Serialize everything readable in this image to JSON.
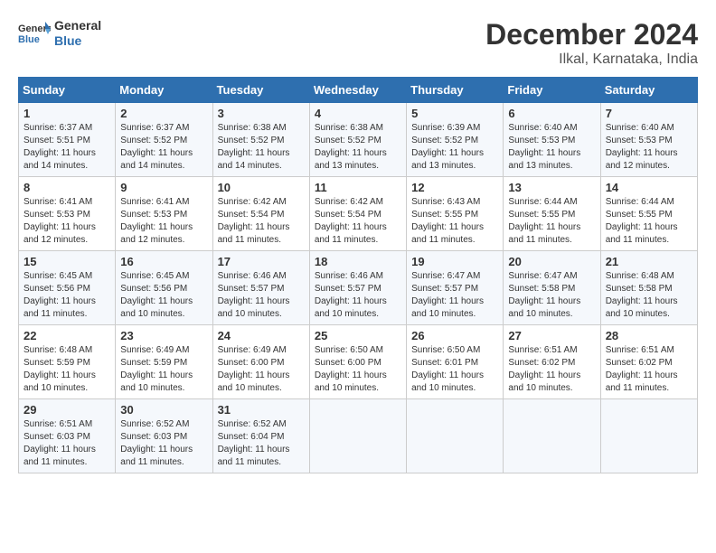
{
  "header": {
    "logo_line1": "General",
    "logo_line2": "Blue",
    "month": "December 2024",
    "location": "Ilkal, Karnataka, India"
  },
  "weekdays": [
    "Sunday",
    "Monday",
    "Tuesday",
    "Wednesday",
    "Thursday",
    "Friday",
    "Saturday"
  ],
  "weeks": [
    [
      {
        "day": "1",
        "sunrise": "6:37 AM",
        "sunset": "5:51 PM",
        "daylight": "Daylight: 11 hours and 14 minutes."
      },
      {
        "day": "2",
        "sunrise": "6:37 AM",
        "sunset": "5:52 PM",
        "daylight": "Daylight: 11 hours and 14 minutes."
      },
      {
        "day": "3",
        "sunrise": "6:38 AM",
        "sunset": "5:52 PM",
        "daylight": "Daylight: 11 hours and 14 minutes."
      },
      {
        "day": "4",
        "sunrise": "6:38 AM",
        "sunset": "5:52 PM",
        "daylight": "Daylight: 11 hours and 13 minutes."
      },
      {
        "day": "5",
        "sunrise": "6:39 AM",
        "sunset": "5:52 PM",
        "daylight": "Daylight: 11 hours and 13 minutes."
      },
      {
        "day": "6",
        "sunrise": "6:40 AM",
        "sunset": "5:53 PM",
        "daylight": "Daylight: 11 hours and 13 minutes."
      },
      {
        "day": "7",
        "sunrise": "6:40 AM",
        "sunset": "5:53 PM",
        "daylight": "Daylight: 11 hours and 12 minutes."
      }
    ],
    [
      {
        "day": "8",
        "sunrise": "6:41 AM",
        "sunset": "5:53 PM",
        "daylight": "Daylight: 11 hours and 12 minutes."
      },
      {
        "day": "9",
        "sunrise": "6:41 AM",
        "sunset": "5:53 PM",
        "daylight": "Daylight: 11 hours and 12 minutes."
      },
      {
        "day": "10",
        "sunrise": "6:42 AM",
        "sunset": "5:54 PM",
        "daylight": "Daylight: 11 hours and 11 minutes."
      },
      {
        "day": "11",
        "sunrise": "6:42 AM",
        "sunset": "5:54 PM",
        "daylight": "Daylight: 11 hours and 11 minutes."
      },
      {
        "day": "12",
        "sunrise": "6:43 AM",
        "sunset": "5:55 PM",
        "daylight": "Daylight: 11 hours and 11 minutes."
      },
      {
        "day": "13",
        "sunrise": "6:44 AM",
        "sunset": "5:55 PM",
        "daylight": "Daylight: 11 hours and 11 minutes."
      },
      {
        "day": "14",
        "sunrise": "6:44 AM",
        "sunset": "5:55 PM",
        "daylight": "Daylight: 11 hours and 11 minutes."
      }
    ],
    [
      {
        "day": "15",
        "sunrise": "6:45 AM",
        "sunset": "5:56 PM",
        "daylight": "Daylight: 11 hours and 11 minutes."
      },
      {
        "day": "16",
        "sunrise": "6:45 AM",
        "sunset": "5:56 PM",
        "daylight": "Daylight: 11 hours and 10 minutes."
      },
      {
        "day": "17",
        "sunrise": "6:46 AM",
        "sunset": "5:57 PM",
        "daylight": "Daylight: 11 hours and 10 minutes."
      },
      {
        "day": "18",
        "sunrise": "6:46 AM",
        "sunset": "5:57 PM",
        "daylight": "Daylight: 11 hours and 10 minutes."
      },
      {
        "day": "19",
        "sunrise": "6:47 AM",
        "sunset": "5:57 PM",
        "daylight": "Daylight: 11 hours and 10 minutes."
      },
      {
        "day": "20",
        "sunrise": "6:47 AM",
        "sunset": "5:58 PM",
        "daylight": "Daylight: 11 hours and 10 minutes."
      },
      {
        "day": "21",
        "sunrise": "6:48 AM",
        "sunset": "5:58 PM",
        "daylight": "Daylight: 11 hours and 10 minutes."
      }
    ],
    [
      {
        "day": "22",
        "sunrise": "6:48 AM",
        "sunset": "5:59 PM",
        "daylight": "Daylight: 11 hours and 10 minutes."
      },
      {
        "day": "23",
        "sunrise": "6:49 AM",
        "sunset": "5:59 PM",
        "daylight": "Daylight: 11 hours and 10 minutes."
      },
      {
        "day": "24",
        "sunrise": "6:49 AM",
        "sunset": "6:00 PM",
        "daylight": "Daylight: 11 hours and 10 minutes."
      },
      {
        "day": "25",
        "sunrise": "6:50 AM",
        "sunset": "6:00 PM",
        "daylight": "Daylight: 11 hours and 10 minutes."
      },
      {
        "day": "26",
        "sunrise": "6:50 AM",
        "sunset": "6:01 PM",
        "daylight": "Daylight: 11 hours and 10 minutes."
      },
      {
        "day": "27",
        "sunrise": "6:51 AM",
        "sunset": "6:02 PM",
        "daylight": "Daylight: 11 hours and 10 minutes."
      },
      {
        "day": "28",
        "sunrise": "6:51 AM",
        "sunset": "6:02 PM",
        "daylight": "Daylight: 11 hours and 11 minutes."
      }
    ],
    [
      {
        "day": "29",
        "sunrise": "6:51 AM",
        "sunset": "6:03 PM",
        "daylight": "Daylight: 11 hours and 11 minutes."
      },
      {
        "day": "30",
        "sunrise": "6:52 AM",
        "sunset": "6:03 PM",
        "daylight": "Daylight: 11 hours and 11 minutes."
      },
      {
        "day": "31",
        "sunrise": "6:52 AM",
        "sunset": "6:04 PM",
        "daylight": "Daylight: 11 hours and 11 minutes."
      },
      null,
      null,
      null,
      null
    ]
  ]
}
